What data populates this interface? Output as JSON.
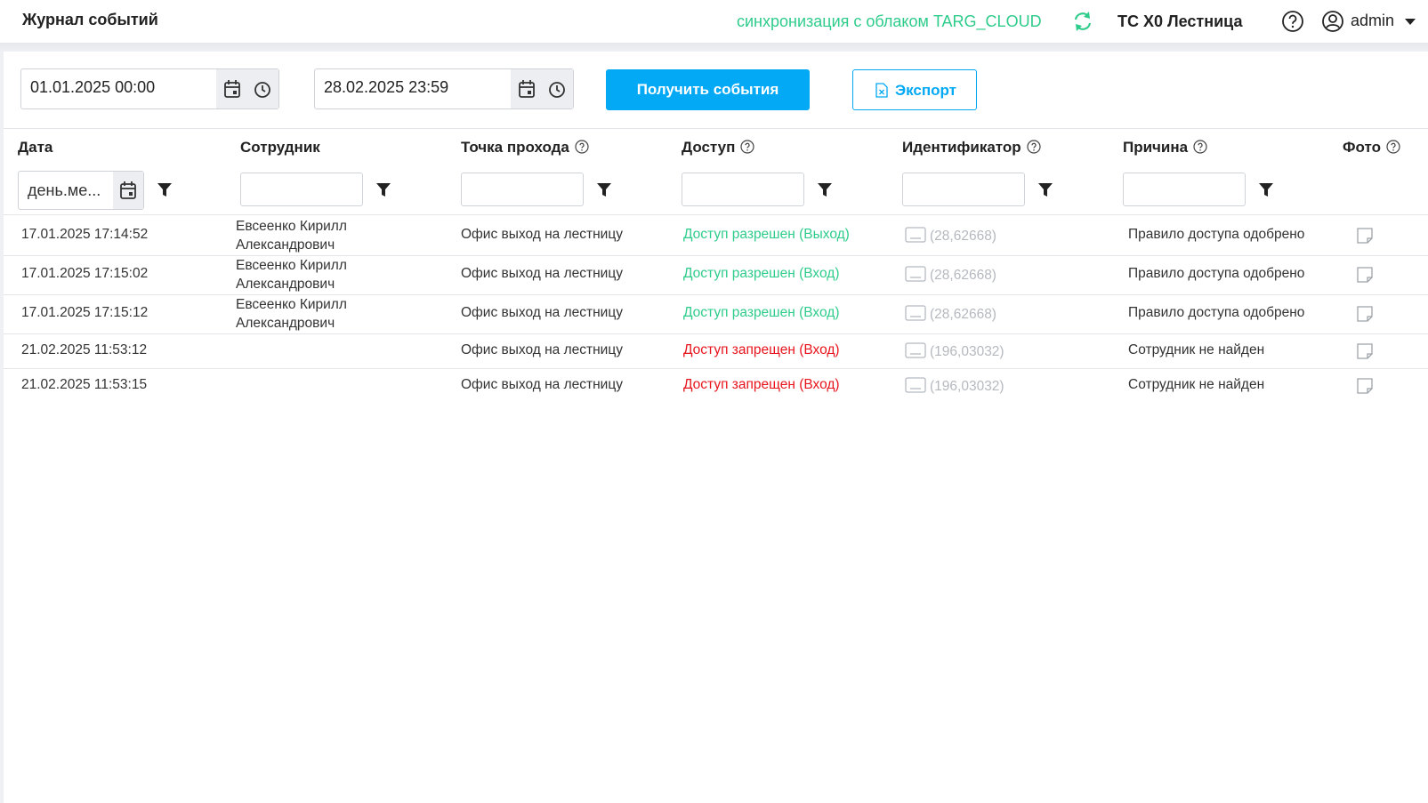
{
  "header": {
    "title": "Журнал событий",
    "sync_label": "синхронизация с облаком TARG_CLOUD",
    "device_name": "ТС Х0 Лестница",
    "user_name": "admin"
  },
  "filters_bar": {
    "date_from": "01.01.2025 00:00",
    "date_to": "28.02.2025 23:59",
    "get_events_label": "Получить события",
    "export_label": "Экспорт"
  },
  "columns": [
    {
      "label": "Дата"
    },
    {
      "label": "Сотрудник"
    },
    {
      "label": "Точка прохода"
    },
    {
      "label": "Доступ"
    },
    {
      "label": "Идентификатор"
    },
    {
      "label": "Причина"
    },
    {
      "label": "Фото"
    }
  ],
  "date_filter_placeholder": "день.ме...",
  "rows": [
    {
      "date": "17.01.2025 17:14:52",
      "employee_line1": "Евсеенко Кирилл",
      "employee_line2": "Александрович",
      "point": "Офис выход на лестницу",
      "access": "Доступ разрешен (Выход)",
      "access_status": "granted",
      "identifier": "(28,62668)",
      "reason": "Правило доступа одобрено"
    },
    {
      "date": "17.01.2025 17:15:02",
      "employee_line1": "Евсеенко Кирилл",
      "employee_line2": "Александрович",
      "point": "Офис выход на лестницу",
      "access": "Доступ разрешен (Вход)",
      "access_status": "granted",
      "identifier": "(28,62668)",
      "reason": "Правило доступа одобрено"
    },
    {
      "date": "17.01.2025 17:15:12",
      "employee_line1": "Евсеенко Кирилл",
      "employee_line2": "Александрович",
      "point": "Офис выход на лестницу",
      "access": "Доступ разрешен (Вход)",
      "access_status": "granted",
      "identifier": "(28,62668)",
      "reason": "Правило доступа одобрено"
    },
    {
      "date": "21.02.2025 11:53:12",
      "employee_line1": "",
      "employee_line2": "",
      "point": "Офис выход на лестницу",
      "access": "Доступ запрещен (Вход)",
      "access_status": "denied",
      "identifier": "(196,03032)",
      "reason": "Сотрудник не найден"
    },
    {
      "date": "21.02.2025 11:53:15",
      "employee_line1": "",
      "employee_line2": "",
      "point": "Офис выход на лестницу",
      "access": "Доступ запрещен (Вход)",
      "access_status": "denied",
      "identifier": "(196,03032)",
      "reason": "Сотрудник не найден"
    }
  ],
  "colors": {
    "accent": "#03a9f4",
    "granted": "#2ecc8b",
    "denied": "#e8141d",
    "identifier": "#b5b9bf"
  }
}
